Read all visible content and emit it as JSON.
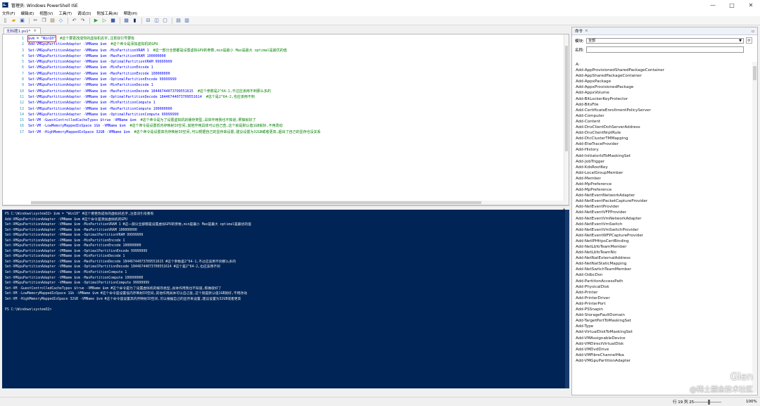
{
  "window": {
    "title": "管理员: Windows PowerShell ISE",
    "min": "—",
    "max": "□",
    "close": "✕"
  },
  "menu": [
    "文件(F)",
    "编辑(E)",
    "视图(V)",
    "工具(T)",
    "调试(D)",
    "附加工具(A)",
    "帮助(H)"
  ],
  "toolbar": [
    "new",
    "open",
    "save",
    "cut",
    "copy",
    "paste",
    "clear",
    "undo",
    "redo",
    "run",
    "run-selection",
    "stop",
    "new-remote",
    "powershell",
    "show-script-top",
    "show-script-right",
    "show-script-max",
    "show-commands",
    "show-addons"
  ],
  "editor_tab": {
    "label": "无标题1.ps1*",
    "close": "×"
  },
  "editor_lines": [
    {
      "n": "1",
      "code": "$vm = \"Win10\"",
      "cmt": "#这个要更改成你的虚拟机名字,注意双引号要有"
    },
    {
      "n": "2",
      "code": "Add-VMGpuPartitionAdapter -VMName $vm",
      "cmt": "#这个命令是添加虚拟机的GPU"
    },
    {
      "n": "3",
      "code": "Set-VMGpuPartitionAdapter -VMName $vm -MinPartitionVRAM 1",
      "cmt": "#这一部分全部都是设置虚拟GPU的参数,min是最小 Max是最大 optimal是最优的值"
    },
    {
      "n": "4",
      "code": "Set-VMGpuPartitionAdapter -VMName $vm -MaxPartitionVRAM 100000000",
      "cmt": ""
    },
    {
      "n": "5",
      "code": "Set-VMGpuPartitionAdapter -VMName $vm -OptimalPartitionVRAM 99999999",
      "cmt": ""
    },
    {
      "n": "6",
      "code": "Set-VMGpuPartitionAdapter -VMName $vm -MinPartitionEncode 1",
      "cmt": ""
    },
    {
      "n": "7",
      "code": "Set-VMGpuPartitionAdapter -VMName $vm -MaxPartitionEncode 100000000",
      "cmt": ""
    },
    {
      "n": "8",
      "code": "Set-VMGpuPartitionAdapter -VMName $vm -OptimalPartitionEncode 99999999",
      "cmt": ""
    },
    {
      "n": "9",
      "code": "Set-VMGpuPartitionAdapter -VMName $vm -MinPartitionDecode 1",
      "cmt": ""
    },
    {
      "n": "10",
      "code": "Set-VMGpuPartitionAdapter -VMName $vm -MaxPartitionDecode 18446744073709551615",
      "cmt": "#这个参数是2^64-1,不过应该用不到那么多的"
    },
    {
      "n": "11",
      "code": "Set-VMGpuPartitionAdapter -VMName $vm -OptimalPartitionDecode 18446744073709551614",
      "cmt": "#这个是2^64-2,也应该用不到"
    },
    {
      "n": "12",
      "code": "Set-VMGpuPartitionAdapter -VMName $vm -MinPartitionCompute 1",
      "cmt": ""
    },
    {
      "n": "13",
      "code": "Set-VMGpuPartitionAdapter -VMName $vm -MaxPartitionCompute 100000000",
      "cmt": ""
    },
    {
      "n": "14",
      "code": "Set-VMGpuPartitionAdapter -VMName $vm -OptimalPartitionCompute 99999999",
      "cmt": ""
    },
    {
      "n": "15",
      "code": "Set-VM -GuestControlledCacheTypes $true -VMName $vm",
      "cmt": "#这个命令是为了设置虚拟机的缓存类型,具体作用我也不知道,照做就好了"
    },
    {
      "n": "16",
      "code": "Set-VM -LowMemoryMappedIoSpace 1Gb -VMName $vm",
      "cmt": "#这个命令是设置低内存映射IO空间,其他作用具体可以自己查,这个就是默认值1GB就好,不用改动"
    },
    {
      "n": "17",
      "code": "Set-VM -HighMemoryMappedIoSpace 32GB -VMName $vm",
      "cmt": "#这个命令是设置高内存映射IO空间,可以根据自己的显存来设置,建议设置为32GB或者更高,超出了自己的显存也没关系"
    }
  ],
  "console_lines": [
    "PS C:\\Windows\\system32> $vm = \"Win10\"    #这个要更改成你的虚拟机名字,注意双引号要有",
    "Add-VMGpuPartitionAdapter -VMName $vm    #这个命令是添加虚拟机的GPU",
    "Set-VMGpuPartitionAdapter -VMName $vm -MinPartitionVRAM 1    #这一部分全部都是设置虚拟GPU的参数,min是最小 Max是最大 optimal是最优的值",
    "Set-VMGpuPartitionAdapter -VMName $vm -MaxPartitionVRAM 100000000",
    "Set-VMGpuPartitionAdapter -VMName $vm -OptimalPartitionVRAM 99999999",
    "Set-VMGpuPartitionAdapter -VMName $vm -MinPartitionEncode 1",
    "Set-VMGpuPartitionAdapter -VMName $vm -MaxPartitionEncode 100000000",
    "Set-VMGpuPartitionAdapter -VMName $vm -OptimalPartitionEncode 99999999",
    "Set-VMGpuPartitionAdapter -VMName $vm -MinPartitionDecode 1",
    "Set-VMGpuPartitionAdapter -VMName $vm -MaxPartitionDecode 18446744073709551615    #这个参数是2^64-1,不过应该用不到那么多的",
    "Set-VMGpuPartitionAdapter -VMName $vm -OptimalPartitionDecode 18446744073709551614    #这个是2^64-2,也应该用不到",
    "Set-VMGpuPartitionAdapter -VMName $vm -MinPartitionCompute 1",
    "Set-VMGpuPartitionAdapter -VMName $vm -MaxPartitionCompute 100000000",
    "Set-VMGpuPartitionAdapter -VMName $vm -OptimalPartitionCompute 99999999",
    "Set-VM -GuestControlledCacheTypes $true -VMName $vm    #这个命令是为了设置虚拟机的缓存类型,具体作用我也不知道,照做就好了",
    "Set-VM -LowMemoryMappedIoSpace 1Gb -VMName $vm    #这个命令是设置低内存映射IO空间,其他作用具体可以自己查,这个就是默认值1GB就好,不用改动",
    "Set-VM -HighMemoryMappedIoSpace 32GB -VMName $vm    #这个命令是设置高内存映射IO空间,可以根据自己的显存来设置,建议设置为32GB或者更高",
    "",
    "PS C:\\Windows\\system32>"
  ],
  "commands_panel": {
    "header": "命令",
    "close": "×",
    "module_label": "模块:",
    "module_value": "全部",
    "name_label": "名称:",
    "name_value": "",
    "items": [
      "A:",
      "Add-AppProvisionedSharedPackageContainer",
      "Add-AppSharedPackageContainer",
      "Add-AppxPackage",
      "Add-AppxProvisionedPackage",
      "Add-AppxVolume",
      "Add-BitLockerKeyProtector",
      "Add-BitsFile",
      "Add-CertificateEnrollmentPolicyServer",
      "Add-Computer",
      "Add-Content",
      "Add-DnsClientDohServerAddress",
      "Add-DnsClientNrptRule",
      "Add-DtcClusterTMMapping",
      "Add-EtwTraceProvider",
      "Add-History",
      "Add-InitiatorIdToMaskingSet",
      "Add-JobTrigger",
      "Add-KdsRootKey",
      "Add-LocalGroupMember",
      "Add-Member",
      "Add-MpPreference",
      "Add-MpPreference",
      "Add-NetEventNetworkAdapter",
      "Add-NetEventPacketCaptureProvider",
      "Add-NetEventProvider",
      "Add-NetEventVFPProvider",
      "Add-NetEventVmNetworkAdapter",
      "Add-NetEventVmSwitch",
      "Add-NetEventVmSwitchProvider",
      "Add-NetEventWFPCaptureProvider",
      "Add-NetIPHttpsCertBinding",
      "Add-NetLbfoTeamMember",
      "Add-NetLbfoTeamNic",
      "Add-NetNatExternalAddress",
      "Add-NetNatStaticMapping",
      "Add-NetSwitchTeamMember",
      "Add-OdbcDsn",
      "Add-PartitionAccessPath",
      "Add-PhysicalDisk",
      "Add-Printer",
      "Add-PrinterDriver",
      "Add-PrinterPort",
      "Add-PSSnapin",
      "Add-StorageFaultDomain",
      "Add-TargetPortToMaskingSet",
      "Add-Type",
      "Add-VirtualDiskToMaskingSet",
      "Add-VMAssignableDevice",
      "Add-VMDirectVirtualDisk",
      "Add-VMDvdDrive",
      "Add-VMFibreChannelHba",
      "Add-VMGpuPartitionAdapter"
    ]
  },
  "statusbar": {
    "position": "行 19 列 25",
    "zoom": "100%"
  },
  "watermark": {
    "line1": "Glen",
    "line2": "@稀土掘金技术社区"
  }
}
